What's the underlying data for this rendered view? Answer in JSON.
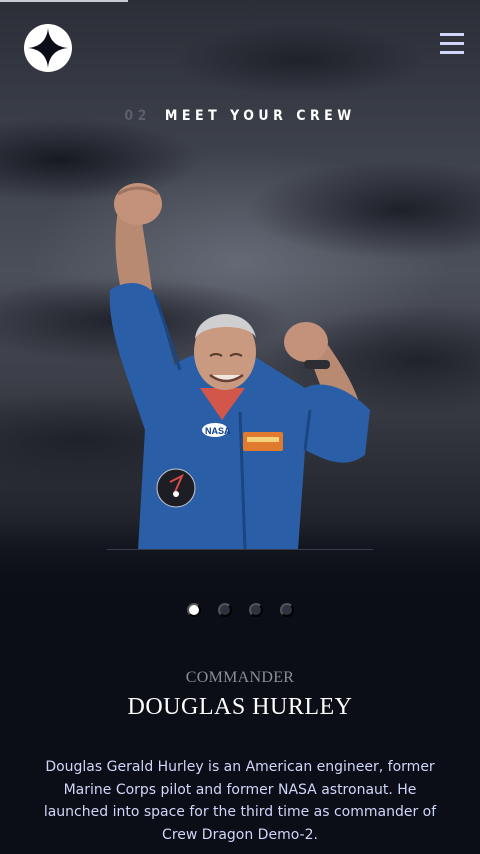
{
  "header": {
    "logo_icon": "four-point-star-logo",
    "menu_icon": "hamburger-icon"
  },
  "page_heading": {
    "number": "02",
    "title": "MEET YOUR CREW"
  },
  "crew": {
    "selected_index": 0,
    "total_members": 4,
    "role": "COMMANDER",
    "name": "DOUGLAS HURLEY",
    "bio": "Douglas Gerald Hurley is an American engineer, former Marine Corps pilot and former NASA astronaut. He launched into space for the third time as commander of Crew Dragon Demo-2.",
    "photo_icon": "astronaut-photo",
    "suit_badge": "NASA"
  },
  "colors": {
    "background": "#0b0d17",
    "accent": "#d0d6f9",
    "dot_inactive": "#2f3240",
    "dot_active": "#ffffff",
    "suit": "#2a5fa8"
  }
}
